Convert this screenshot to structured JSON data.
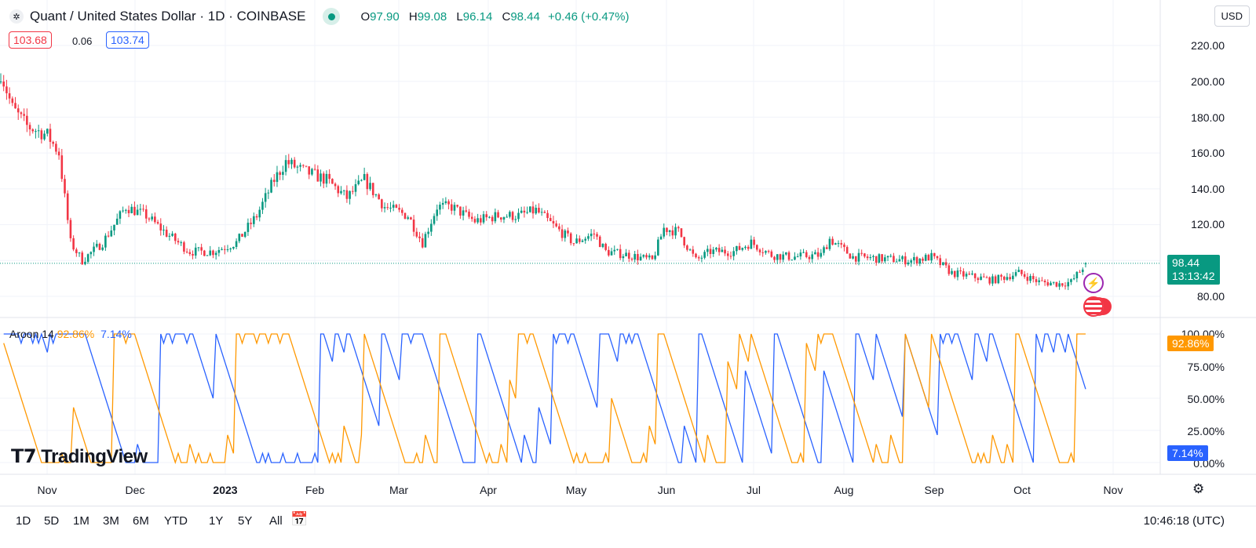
{
  "header": {
    "title": "Quant / United States Dollar · 1D · COINBASE",
    "open_label": "O",
    "open": "97.90",
    "high_label": "H",
    "high": "99.08",
    "low_label": "L",
    "low": "96.14",
    "close_label": "C",
    "close": "98.44",
    "change": "+0.46 (+0.47%)",
    "currency": "USD"
  },
  "spread": {
    "bid": "103.68",
    "spread": "0.06",
    "ask": "103.74"
  },
  "price_axis": [
    "220.00",
    "200.00",
    "180.00",
    "160.00",
    "140.00",
    "120.00",
    "80.00"
  ],
  "last_price": {
    "value": "98.44",
    "countdown": "13:13:42"
  },
  "indicator": {
    "name": "Aroon",
    "length": "14",
    "up": "92.86%",
    "down": "7.14%",
    "axis": [
      "100.00%",
      "75.00%",
      "50.00%",
      "25.00%",
      "0.00%"
    ],
    "up_color": "#ff9800",
    "down_color": "#2962ff"
  },
  "time_axis": [
    "Nov",
    "Dec",
    "2023",
    "Feb",
    "Mar",
    "Apr",
    "May",
    "Jun",
    "Jul",
    "Aug",
    "Sep",
    "Oct",
    "Nov"
  ],
  "ranges": [
    "1D",
    "5D",
    "1M",
    "3M",
    "6M",
    "YTD",
    "1Y",
    "5Y",
    "All"
  ],
  "clock": "10:46:18 (UTC)",
  "watermark": "TradingView",
  "colors": {
    "up": "#089981",
    "down": "#f23645"
  },
  "chart_data": {
    "type": "candlestick",
    "symbol": "QNT/USD",
    "interval": "1D",
    "ylim": [
      75,
      225
    ],
    "anchor_closes": [
      [
        "2022-10-16",
        205
      ],
      [
        "2022-10-20",
        185
      ],
      [
        "2022-10-25",
        175
      ],
      [
        "2022-11-01",
        170
      ],
      [
        "2022-11-05",
        160
      ],
      [
        "2022-11-09",
        110
      ],
      [
        "2022-11-13",
        100
      ],
      [
        "2022-11-20",
        110
      ],
      [
        "2022-11-28",
        130
      ],
      [
        "2022-12-05",
        125
      ],
      [
        "2022-12-12",
        115
      ],
      [
        "2022-12-20",
        105
      ],
      [
        "2022-12-28",
        105
      ],
      [
        "2023-01-05",
        110
      ],
      [
        "2023-01-12",
        125
      ],
      [
        "2023-01-18",
        145
      ],
      [
        "2023-01-22",
        155
      ],
      [
        "2023-01-28",
        150
      ],
      [
        "2023-02-05",
        145
      ],
      [
        "2023-02-12",
        135
      ],
      [
        "2023-02-18",
        145
      ],
      [
        "2023-02-25",
        130
      ],
      [
        "2023-03-05",
        125
      ],
      [
        "2023-03-10",
        110
      ],
      [
        "2023-03-15",
        130
      ],
      [
        "2023-03-20",
        130
      ],
      [
        "2023-03-28",
        122
      ],
      [
        "2023-04-05",
        125
      ],
      [
        "2023-04-12",
        125
      ],
      [
        "2023-04-18",
        128
      ],
      [
        "2023-04-25",
        118
      ],
      [
        "2023-05-01",
        110
      ],
      [
        "2023-05-08",
        115
      ],
      [
        "2023-05-12",
        105
      ],
      [
        "2023-05-20",
        103
      ],
      [
        "2023-05-28",
        100
      ],
      [
        "2023-06-01",
        118
      ],
      [
        "2023-06-06",
        116
      ],
      [
        "2023-06-12",
        100
      ],
      [
        "2023-06-17",
        105
      ],
      [
        "2023-06-25",
        105
      ],
      [
        "2023-07-01",
        110
      ],
      [
        "2023-07-08",
        103
      ],
      [
        "2023-07-15",
        102
      ],
      [
        "2023-07-25",
        103
      ],
      [
        "2023-07-28",
        112
      ],
      [
        "2023-08-05",
        102
      ],
      [
        "2023-08-15",
        101
      ],
      [
        "2023-08-25",
        100
      ],
      [
        "2023-09-01",
        102
      ],
      [
        "2023-09-08",
        93
      ],
      [
        "2023-09-15",
        91
      ],
      [
        "2023-09-22",
        89
      ],
      [
        "2023-10-01",
        93
      ],
      [
        "2023-10-08",
        88
      ],
      [
        "2023-10-15",
        87
      ],
      [
        "2023-10-19",
        88
      ],
      [
        "2023-10-22",
        94
      ],
      [
        "2023-10-24",
        98.44
      ]
    ]
  }
}
